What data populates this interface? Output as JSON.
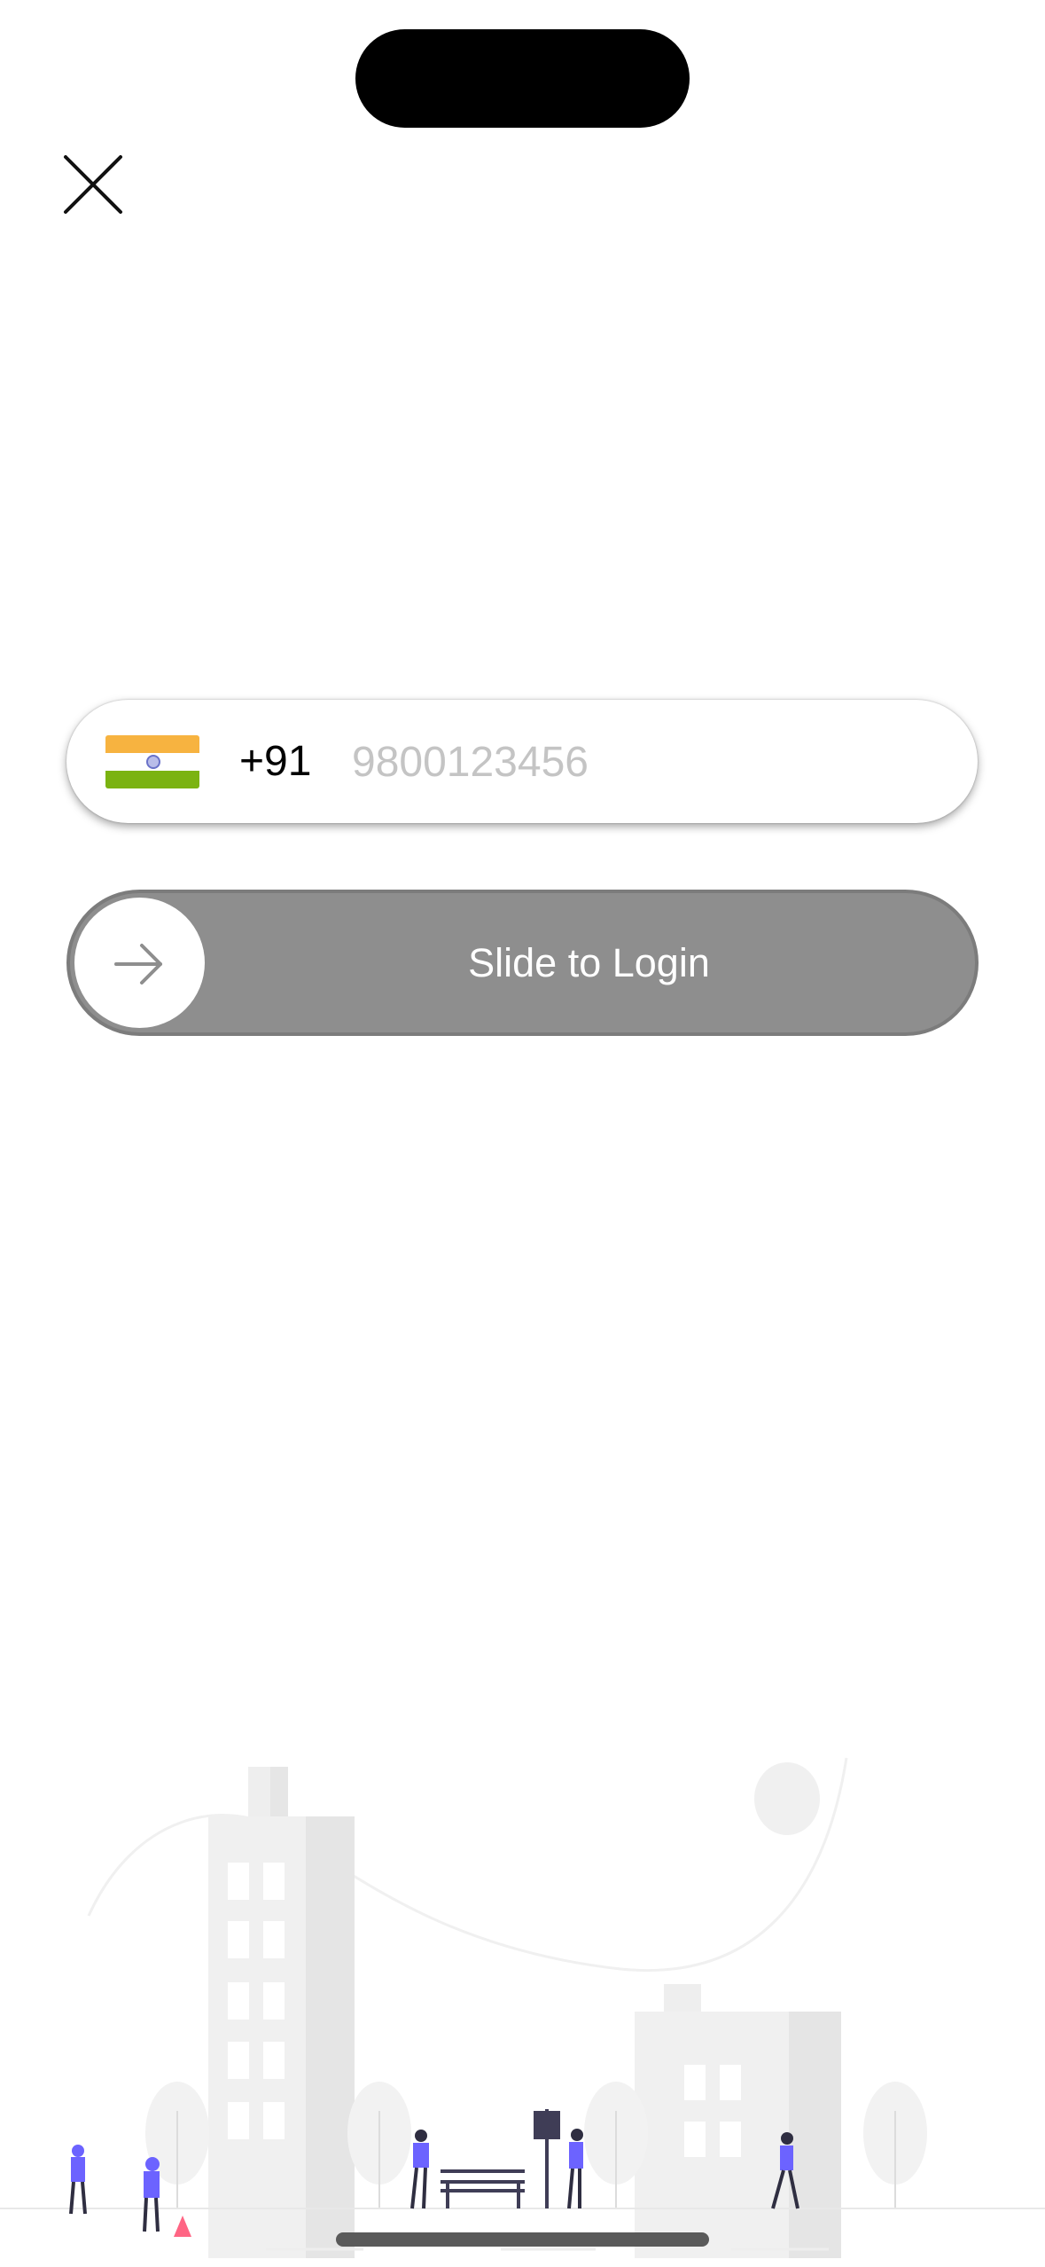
{
  "phone": {
    "country_code": "+91",
    "value": "",
    "placeholder": "9800123456",
    "flag": {
      "icon": "india-flag-icon",
      "colors": {
        "saffron": "#f7b340",
        "white": "#ffffff",
        "green": "#7bb311",
        "chakra": "#6a72c8"
      }
    }
  },
  "slider": {
    "label": "Slide to Login",
    "knob_icon": "arrow-right-icon",
    "track_color": "#8e8e8e"
  },
  "close_icon": "close-icon",
  "illustration": {
    "name": "city-street-illustration",
    "accent": "#6c63ff"
  }
}
